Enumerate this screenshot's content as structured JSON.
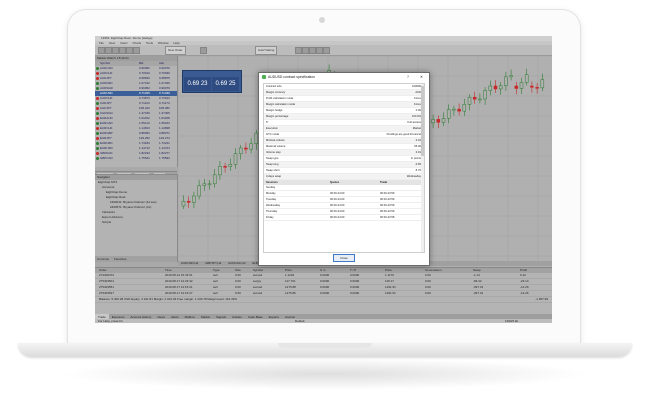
{
  "app": {
    "title": "14951: EightCap Real - Demo [Hedge]",
    "menu": [
      "File",
      "View",
      "Insert",
      "Charts",
      "Tools",
      "Window",
      "Help"
    ],
    "toolbar": {
      "new_order_label": "New Order",
      "autotrading_label": "AutoTrading"
    }
  },
  "market_watch": {
    "title": "Market Watch: 15:43:21",
    "columns": [
      "Symbol",
      "Bid",
      "Ask"
    ],
    "rows": [
      {
        "symbol": "AUDCAD",
        "bid": "0.96052",
        "ask": "0.96079",
        "color": "#2e7d32"
      },
      {
        "symbol": "AUDCHF",
        "bid": "0.70910",
        "ask": "0.70939",
        "color": "#c62828"
      },
      {
        "symbol": "AUDJPY",
        "bid": "0.68833",
        "ask": "0.68875",
        "color": "#c62828"
      },
      {
        "symbol": "AUDNZD",
        "bid": "1.07312",
        "ask": "1.07346",
        "color": "#2e7d32"
      },
      {
        "symbol": "AUDSGD",
        "bid": "0.96052",
        "ask": "0.96079",
        "color": "#2e7d32"
      },
      {
        "symbol": "AUDUSD",
        "bid": "0.71325",
        "ask": "0.71336",
        "color": "#3b5f99",
        "selected": true
      },
      {
        "symbol": "CADCHF",
        "bid": "0.73873",
        "ask": "0.73913",
        "color": "#c62828"
      },
      {
        "symbol": "CADJPY",
        "bid": "0.71123",
        "ask": "0.71173",
        "color": "#2e7d32"
      },
      {
        "symbol": "CHFJPY",
        "bid": "108.422",
        "ask": "108.482",
        "color": "#c62828"
      },
      {
        "symbol": "CHFSGD",
        "bid": "1.37340",
        "ask": "1.37405",
        "color": "#2e7d32"
      },
      {
        "symbol": "EURAUD",
        "bid": "1.61152",
        "ask": "1.61188",
        "color": "#c62828"
      },
      {
        "symbol": "EURCAD",
        "bid": "1.55113",
        "ask": "1.55153",
        "color": "#2e7d32"
      },
      {
        "symbol": "EURCHF",
        "bid": "1.14813",
        "ask": "1.14838",
        "color": "#c62828"
      },
      {
        "symbol": "EURGBP",
        "bid": "0.88352",
        "ask": "0.88371",
        "color": "#2e7d32"
      },
      {
        "symbol": "EURJPY",
        "bid": "129.252",
        "ask": "129.274",
        "color": "#c62828"
      },
      {
        "symbol": "EURNZD",
        "bid": "1.73183",
        "ask": "1.73241",
        "color": "#2e7d32"
      },
      {
        "symbol": "EURUSD",
        "bid": "1.14712",
        "ask": "1.14724",
        "color": "#2e7d32"
      },
      {
        "symbol": "GBPAUD",
        "bid": "1.82233",
        "ask": "1.82277",
        "color": "#c62828"
      },
      {
        "symbol": "GBPCAD",
        "bid": "1.75541",
        "ask": "1.75593",
        "color": "#2e7d32"
      }
    ],
    "tabs": [
      "Symbols",
      "Details",
      "Trading",
      "Ticks"
    ]
  },
  "navigator": {
    "title": "Navigator",
    "items": [
      "EightCap MT4",
      "Accounts",
      "EightCap Demo",
      "EightCap Real",
      "1600011: Bryana Ondrusz (14 ass)",
      "2400571: Bryana Ondrusz (Ac)",
      "Indicators",
      "Expert Advisors",
      "Scripts"
    ],
    "tabs": [
      "Common",
      "Favorites"
    ]
  },
  "trade_panel": {
    "sell": "0.69 23",
    "buy": "0.69 25",
    "sell_label": "SELL",
    "buy_label": "BUY",
    "lot": "1.00"
  },
  "chart_tabs": [
    "AUDUSD,H4",
    "GBPJPY,H4",
    "AUDCAD,H4",
    "EURUSD,H4"
  ],
  "dialog": {
    "title": "AUDUSD contract specification",
    "help": "?",
    "close_x": "✕",
    "specs": [
      {
        "k": "Contract size",
        "v": "100000"
      },
      {
        "k": "Margin currency",
        "v": "AUD"
      },
      {
        "k": "Profit calculation mode",
        "v": "Forex"
      },
      {
        "k": "Margin calculation mode",
        "v": "Forex"
      },
      {
        "k": "Margin hedge",
        "v": "0.00"
      },
      {
        "k": "Margin percentage",
        "v": "100.0%"
      },
      {
        "k": "Tr",
        "v": "Full access"
      },
      {
        "k": "Execution",
        "v": "Market"
      },
      {
        "k": "GTC mode",
        "v": "Pendings are good till cancel"
      },
      {
        "k": "Minimal volume",
        "v": "0.01"
      },
      {
        "k": "Maximal volume",
        "v": "65.00"
      },
      {
        "k": "Volume step",
        "v": "0.01"
      },
      {
        "k": "Swap type",
        "v": "In points"
      },
      {
        "k": "Swap long",
        "v": "-0.65"
      },
      {
        "k": "Swap short",
        "v": "-5.70"
      },
      {
        "k": "3-days swap",
        "v": "Wednesday"
      }
    ],
    "session_headers": [
      "Sessions",
      "Quotes",
      "Trade"
    ],
    "sessions": [
      {
        "day": "Sunday",
        "quotes": "",
        "trade": ""
      },
      {
        "day": "Monday",
        "quotes": "00:00-24:00",
        "trade": "00:00-23:59"
      },
      {
        "day": "Tuesday",
        "quotes": "00:00-24:00",
        "trade": "00:00-23:59"
      },
      {
        "day": "Wednesday",
        "quotes": "00:00-24:00",
        "trade": "00:00-23:59"
      },
      {
        "day": "Thursday",
        "quotes": "00:00-24:00",
        "trade": "00:00-23:59"
      },
      {
        "day": "Friday",
        "quotes": "00:00-24:00",
        "trade": "00:00-23:58"
      }
    ],
    "close_button": "Close"
  },
  "terminal": {
    "headers": [
      "Order",
      "Time",
      "Type",
      "Size",
      "Symbol",
      "Price",
      "S / L",
      "T / P",
      "Price",
      "Commission",
      "Swap",
      "Profit"
    ],
    "rows": [
      [
        "274400472",
        "2019.08.12 15:43:51",
        "sell",
        "0.00",
        "eurusd",
        "1.1204",
        "0.0000",
        "0.0000",
        "1.1176",
        "0.00",
        "-1.14",
        "0.12"
      ],
      [
        "275404501",
        "2019.08.17 12:23:32",
        "sell",
        "0.00",
        "eurjpy",
        "117.701",
        "0.0000",
        "0.0000",
        "115.17",
        "0.00",
        "-66.32",
        "-23.14"
      ],
      [
        "275403551",
        "2019.08.17 12:15:21",
        "sell",
        "0.00",
        "eurusd",
        "1275.88",
        "0.0000",
        "0.0000",
        "1291.51",
        "0.00",
        "-397.31",
        "-12.26"
      ],
      [
        "275403527",
        "2019.08.17 12:15:27",
        "sell",
        "0.00",
        "eurusd",
        "1275.86",
        "0.0000",
        "0.0000",
        "1291.51",
        "0.00",
        "-397.31",
        "-12.26"
      ]
    ],
    "balance_line": "Balance: 5 300.28 USD  Equity: 3 231.81  Margin: 2 001.03  Free margin: 1 230.78  Margin level: 161.33%",
    "balance_total": "-1 657.99",
    "tabs": [
      "Trade",
      "Exposure",
      "Account History",
      "News",
      "Alerts",
      "Mailbox",
      "Market",
      "Signals",
      "Articles",
      "Code Base",
      "Experts",
      "Journal"
    ]
  },
  "status": {
    "help": "For Help, press F1",
    "profile": "Default",
    "memory": "1360/3 kb"
  },
  "colors": {
    "bull": "#2e7d32",
    "bear": "#c62828",
    "accent": "#3b78c9"
  }
}
